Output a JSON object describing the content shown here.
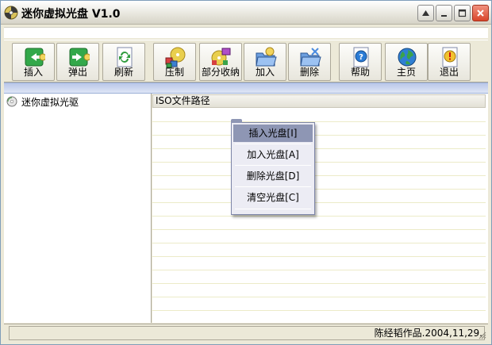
{
  "window": {
    "title": "迷你虚拟光盘 V1.0",
    "app_icon": "cd-disc-icon",
    "controls": [
      {
        "name": "help-button",
        "icon": "help-triangle-icon"
      },
      {
        "name": "minimize-button",
        "icon": "minimize-icon"
      },
      {
        "name": "maximize-button",
        "icon": "maximize-icon"
      },
      {
        "name": "close-button",
        "icon": "close-icon"
      }
    ]
  },
  "toolbar": {
    "items": [
      {
        "label": "插入",
        "icon": "insert-arrow-icon"
      },
      {
        "label": "弹出",
        "icon": "eject-arrow-icon"
      },
      {
        "label": "刷新",
        "icon": "refresh-icon"
      },
      {
        "label": "压制",
        "icon": "compress-disc-icon"
      },
      {
        "label": "部分收纳",
        "icon": "partial-store-icon"
      },
      {
        "label": "加入",
        "icon": "add-folder-icon"
      },
      {
        "label": "删除",
        "icon": "delete-folder-icon"
      },
      {
        "label": "帮助",
        "icon": "help-icon"
      },
      {
        "label": "主页",
        "icon": "globe-home-icon"
      },
      {
        "label": "退出",
        "icon": "exit-icon"
      }
    ]
  },
  "tree": {
    "root_label": "迷你虚拟光驱",
    "root_icon": "cd-drive-icon"
  },
  "list": {
    "column_header": "ISO文件路径"
  },
  "context_menu": {
    "items": [
      {
        "label": "插入光盘[I]",
        "selected": true
      },
      {
        "label": "加入光盘[A]",
        "selected": false
      },
      {
        "label": "删除光盘[D]",
        "selected": false
      },
      {
        "label": "清空光盘[C]",
        "selected": false
      }
    ]
  },
  "status": {
    "text": "陈经韬作品.2004,11,29."
  },
  "colors": {
    "face": "#ece9d8",
    "highlight": "#8e96b4",
    "band": "#b9c7e8"
  }
}
